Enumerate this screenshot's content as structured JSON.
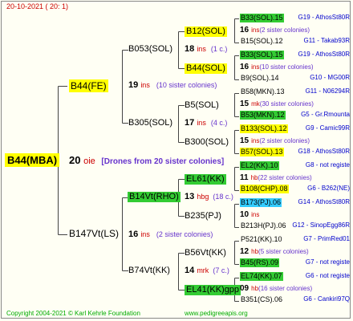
{
  "header": {
    "date": "20-10-2021 ( 20: 1)"
  },
  "footer": {
    "copyright": "Copyright 2004-2021 © Karl Kehrle Foundation",
    "site": "www.pedigreeapis.org"
  },
  "center": {
    "num": "20",
    "ins": "oie",
    "note": "[Drones from 20 sister colonies]"
  },
  "nodes": {
    "root": "B44(MBA)",
    "sire": "B44(FE)",
    "dam": "B147Vt(LS)",
    "s_s": "B053(SOL)",
    "s_d": "B305(SOL)",
    "d_s": "B14Vt(RHO)",
    "d_d": "B74Vt(KK)",
    "g1": "B12(SOL)",
    "g2": "B44(SOL)",
    "g3": "B5(SOL)",
    "g4": "B300(SOL)",
    "g5": "EL61(KK)",
    "g6": "B235(PJ)",
    "g7": "B56Vt(KK)",
    "g8": "EL41(KK)gpp"
  },
  "mid_counts": {
    "sire": {
      "num": "19",
      "ins": "ins",
      "note": "(10 sister colonies)"
    },
    "dam": {
      "num": "16",
      "ins": "ins",
      "note": "(2 sister colonies)"
    },
    "s_s": {
      "num": "18",
      "ins": "ins",
      "note": "(1 c.)"
    },
    "s_d": {
      "num": "17",
      "ins": "ins",
      "note": "(4 c.)"
    },
    "d_s": {
      "num": "13",
      "ins": "hbg",
      "note": "(18 c.)"
    },
    "d_d": {
      "num": "14",
      "ins": "mrk",
      "note": "(7 c.)"
    }
  },
  "rows": [
    {
      "name": "B33(SOL).15",
      "src": "G19 - AthosSt80R",
      "hl": "g"
    },
    {
      "num": "16",
      "ins": "ins",
      "note": "(2 sister colonies)"
    },
    {
      "name": "B15(SOL).12",
      "src": "G11 - Takab93R",
      "hl": ""
    },
    {
      "name": "B33(SOL).15",
      "src": "G19 - AthosSt80R",
      "hl": "g"
    },
    {
      "num": "16",
      "ins": "ins",
      "note": "(10 sister colonies)"
    },
    {
      "name": "B9(SOL).14",
      "src": "G10 - MG00R",
      "hl": ""
    },
    {
      "name": "B58(MKN).13",
      "src": "G11 - N06294R",
      "hl": ""
    },
    {
      "num": "15",
      "ins": "mk",
      "note": "(30 sister colonies)"
    },
    {
      "name": "B53(MKN).12",
      "src": "G5 - Gr.Rmounta",
      "hl": "g"
    },
    {
      "name": "B133(SOL).12",
      "src": "G9 - Camic99R",
      "hl": "y"
    },
    {
      "num": "15",
      "ins": "ins",
      "note": "(2 sister colonies)"
    },
    {
      "name": "B57(SOL).13",
      "src": "G18 - AthosSt80R",
      "hl": "y"
    },
    {
      "name": "EL2(KK).10",
      "src": "G8 - not registe",
      "hl": "g"
    },
    {
      "num": "11",
      "ins": "hb",
      "note": "(22 sister colonies)"
    },
    {
      "name": "B108(CHP).08",
      "src": "G6 - B262(NE)",
      "hl": "y"
    },
    {
      "name": "B173(PJ).06",
      "src": "G14 - AthosSt80R",
      "hl": "c"
    },
    {
      "num": "10",
      "ins": "ins",
      "note": ""
    },
    {
      "name": "B213H(PJ).06",
      "src": "G12 - SinopEgg86R",
      "hl": ""
    },
    {
      "name": "P521(KK).10",
      "src": "G7 - PrimRed01",
      "hl": ""
    },
    {
      "num": "12",
      "ins": "hb",
      "note": "(5 sister colonies)"
    },
    {
      "name": "B45(RS).09",
      "src": "G7 - not registe",
      "hl": "g"
    },
    {
      "name": "EL74(KK).07",
      "src": "G6 - not registe",
      "hl": "g"
    },
    {
      "num": "09",
      "ins": "hb",
      "note": "(16 sister colonies)"
    },
    {
      "name": "B351(CS).06",
      "src": "G6 - Cankiri97Q",
      "hl": ""
    }
  ],
  "colors": {
    "background": "#fffff4",
    "highlight_yellow": "#ffff00",
    "highlight_green": "#33cc33",
    "highlight_cyan": "#33ccff",
    "count_red": "#cc0000",
    "note_purple": "#6633cc",
    "source_blue": "#0000cc"
  }
}
